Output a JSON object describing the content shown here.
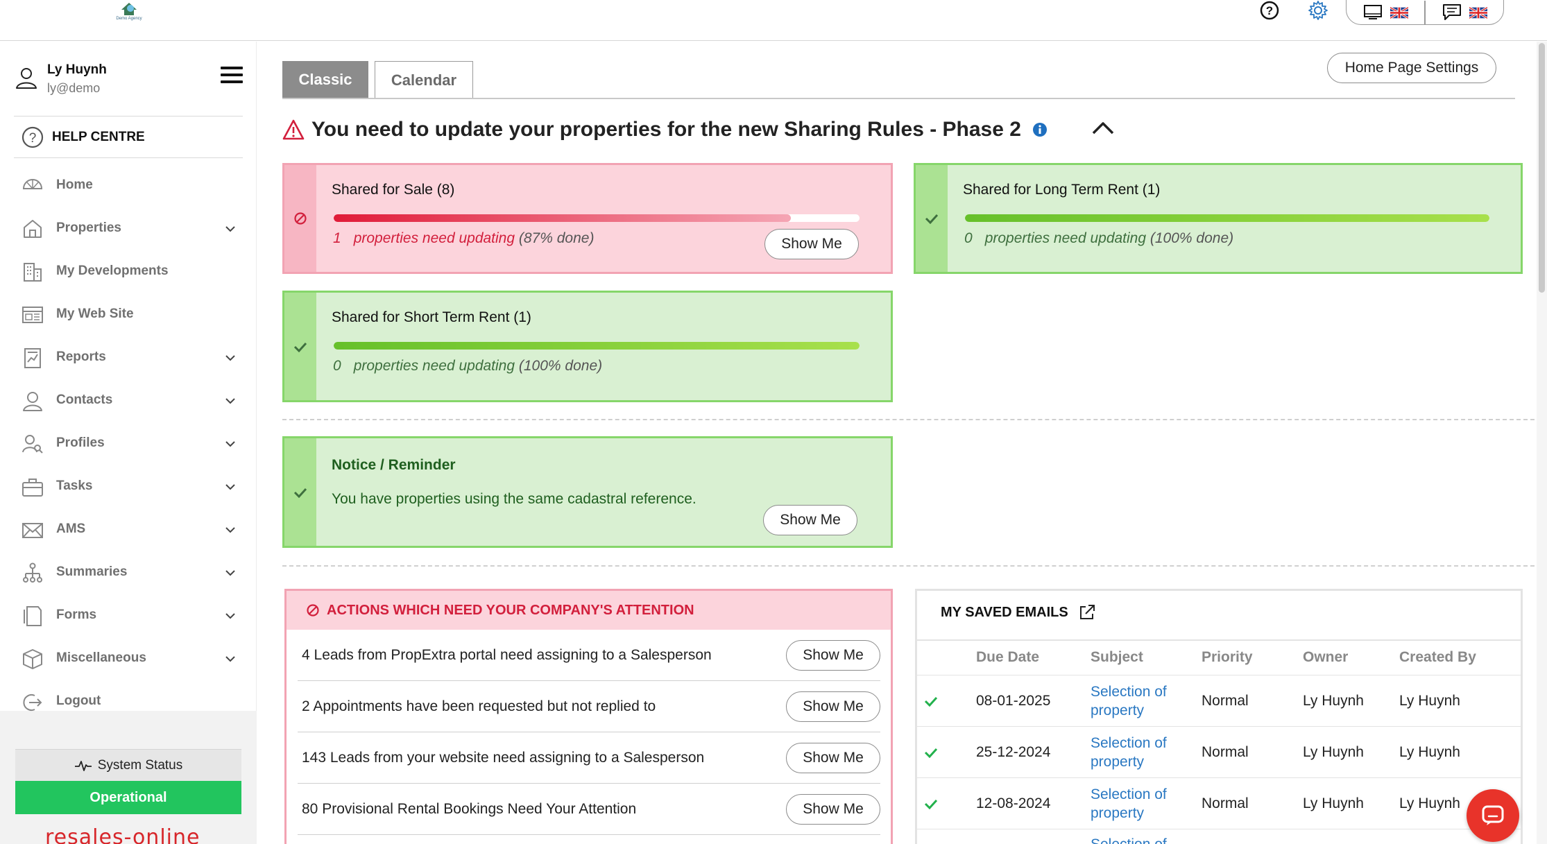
{
  "brand": {
    "logo_text": "Demo Agency",
    "footer_logo": "resales-online"
  },
  "user": {
    "name": "Ly Huynh",
    "email": "ly@demo"
  },
  "help_centre": "HELP CENTRE",
  "nav": [
    {
      "label": "Home",
      "icon": "home-icon",
      "has_chevron": false
    },
    {
      "label": "Properties",
      "icon": "house-icon",
      "has_chevron": true
    },
    {
      "label": "My Developments",
      "icon": "building-icon",
      "has_chevron": false
    },
    {
      "label": "My Web Site",
      "icon": "website-icon",
      "has_chevron": false
    },
    {
      "label": "Reports",
      "icon": "report-icon",
      "has_chevron": true
    },
    {
      "label": "Contacts",
      "icon": "contact-icon",
      "has_chevron": true
    },
    {
      "label": "Profiles",
      "icon": "profiles-icon",
      "has_chevron": true
    },
    {
      "label": "Tasks",
      "icon": "briefcase-icon",
      "has_chevron": true
    },
    {
      "label": "AMS",
      "icon": "envelope-icon",
      "has_chevron": true
    },
    {
      "label": "Summaries",
      "icon": "hierarchy-icon",
      "has_chevron": true
    },
    {
      "label": "Forms",
      "icon": "forms-icon",
      "has_chevron": true
    },
    {
      "label": "Miscellaneous",
      "icon": "box-icon",
      "has_chevron": true
    },
    {
      "label": "Logout",
      "icon": "logout-icon",
      "has_chevron": false
    }
  ],
  "system_status": {
    "label": "System Status",
    "value": "Operational"
  },
  "tabs": {
    "classic": "Classic",
    "calendar": "Calendar",
    "active": "Classic"
  },
  "home_page_settings": "Home Page Settings",
  "alert": {
    "title": "You need to update your properties for the new Sharing Rules - Phase 2"
  },
  "sharing": [
    {
      "title": "Shared for Sale (8)",
      "count": "1",
      "status_text": "properties need updating",
      "percent_text": "(87% done)",
      "progress": 0.87,
      "state": "error",
      "button": "Show Me"
    },
    {
      "title": "Shared for Long Term Rent (1)",
      "count": "0",
      "status_text": "properties need updating",
      "percent_text": "(100% done)",
      "progress": 1.0,
      "state": "ok"
    },
    {
      "title": "Shared for Short Term Rent (1)",
      "count": "0",
      "status_text": "properties need updating",
      "percent_text": "(100% done)",
      "progress": 1.0,
      "state": "ok"
    }
  ],
  "notice": {
    "title": "Notice / Reminder",
    "text": "You have properties using the same cadastral reference.",
    "button": "Show Me"
  },
  "actions": {
    "title": "ACTIONS WHICH NEED YOUR COMPANY'S ATTENTION",
    "items": [
      {
        "text": "4 Leads from PropExtra portal need assigning to a Salesperson",
        "button": "Show Me"
      },
      {
        "text": "2 Appointments have been requested but not replied to",
        "button": "Show Me"
      },
      {
        "text": "143 Leads from your website need assigning to a Salesperson",
        "button": "Show Me"
      },
      {
        "text": "80 Provisional Rental Bookings Need Your Attention",
        "button": "Show Me"
      }
    ]
  },
  "saved_emails": {
    "title": "MY SAVED EMAILS",
    "columns": [
      "Due Date",
      "Subject",
      "Priority",
      "Owner",
      "Created By"
    ],
    "rows": [
      {
        "due": "08-01-2025",
        "subject": "Selection of property",
        "priority": "Normal",
        "owner": "Ly Huynh",
        "created_by": "Ly Huynh"
      },
      {
        "due": "25-12-2024",
        "subject": "Selection of property",
        "priority": "Normal",
        "owner": "Ly Huynh",
        "created_by": "Ly Huynh"
      },
      {
        "due": "12-08-2024",
        "subject": "Selection of property",
        "priority": "Normal",
        "owner": "Ly Huynh",
        "created_by": "Ly Huynh"
      },
      {
        "due": "",
        "subject": "Selection of",
        "priority": "",
        "owner": "",
        "created_by": ""
      }
    ]
  },
  "colors": {
    "error": "#d21f3c",
    "ok": "#1f5f1f",
    "link": "#2a78c2",
    "operational": "#22c55e",
    "accent_blue": "#2a78c2"
  }
}
